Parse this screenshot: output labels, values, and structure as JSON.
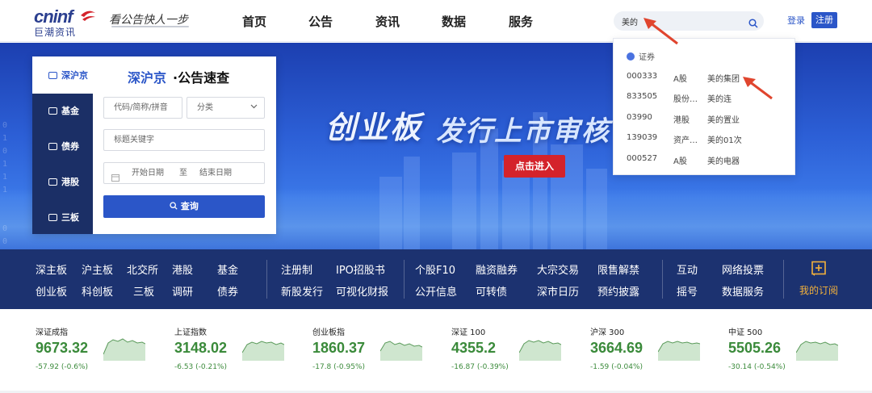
{
  "header": {
    "logo_text": "cninf",
    "logo_sub": "巨潮资讯",
    "slogan": "看公告快人一步",
    "nav": [
      "首页",
      "公告",
      "资讯",
      "数据",
      "服务"
    ],
    "search_value": "美的",
    "login": "登录",
    "register": "注册"
  },
  "banner": {
    "title_part1": "创业板",
    "title_part2": "发行上市审核",
    "enter_button": "点击进入",
    "binary_text": "0\n1\n0\n1\n1\n1\n\n\n0\n0"
  },
  "panel": {
    "tabs": [
      "深沪京",
      "基金",
      "债券",
      "港股",
      "三板"
    ],
    "title_accent": "深沪京",
    "title_rest": "·公告速查",
    "code_placeholder": "代码/简称/拼音",
    "category": "分类",
    "keyword_placeholder": "标题关键字",
    "start_date": "开始日期",
    "date_sep": "至",
    "end_date": "结束日期",
    "query_button": "查询"
  },
  "dropdown": {
    "header": "证券",
    "rows": [
      {
        "code": "000333",
        "market": "A股",
        "name": "美的集团"
      },
      {
        "code": "833505",
        "market": "股份…",
        "name": "美的连"
      },
      {
        "code": "03990",
        "market": "港股",
        "name": "美的置业"
      },
      {
        "code": "139039",
        "market": "资产…",
        "name": "美的01次"
      },
      {
        "code": "000527",
        "market": "A股",
        "name": "美的电器"
      }
    ]
  },
  "menu": {
    "group1_row1": [
      "深主板",
      "沪主板",
      "北交所",
      "港股",
      "基金"
    ],
    "group1_row2": [
      "创业板",
      "科创板",
      "三板",
      "调研",
      "债券"
    ],
    "group2_row1": [
      "注册制",
      "IPO招股书"
    ],
    "group2_row2": [
      "新股发行",
      "可视化财报"
    ],
    "group3_row1": [
      "个股F10",
      "融资融券",
      "大宗交易",
      "限售解禁"
    ],
    "group3_row2": [
      "公开信息",
      "可转债",
      "深市日历",
      "预约披露"
    ],
    "group4_row1": [
      "互动",
      "网络投票"
    ],
    "group4_row2": [
      "摇号",
      "数据服务"
    ],
    "subscribe": "我的订阅"
  },
  "indices": [
    {
      "name": "深证成指",
      "value": "9673.32",
      "change": "-57.92 (-0.6%)"
    },
    {
      "name": "上证指数",
      "value": "3148.02",
      "change": "-6.53 (-0.21%)"
    },
    {
      "name": "创业板指",
      "value": "1860.37",
      "change": "-17.8 (-0.95%)"
    },
    {
      "name": "深证 100",
      "value": "4355.2",
      "change": "-16.87 (-0.39%)"
    },
    {
      "name": "沪深 300",
      "value": "3664.69",
      "change": "-1.59 (-0.04%)"
    },
    {
      "name": "中证 500",
      "value": "5505.26",
      "change": "-30.14 (-0.54%)"
    }
  ],
  "colors": {
    "brand_blue": "#2b56c8",
    "nav_dark": "#1c3270",
    "enter_red": "#d4232b",
    "index_green": "#3a8a3a",
    "arrow_red": "#e0452e"
  }
}
